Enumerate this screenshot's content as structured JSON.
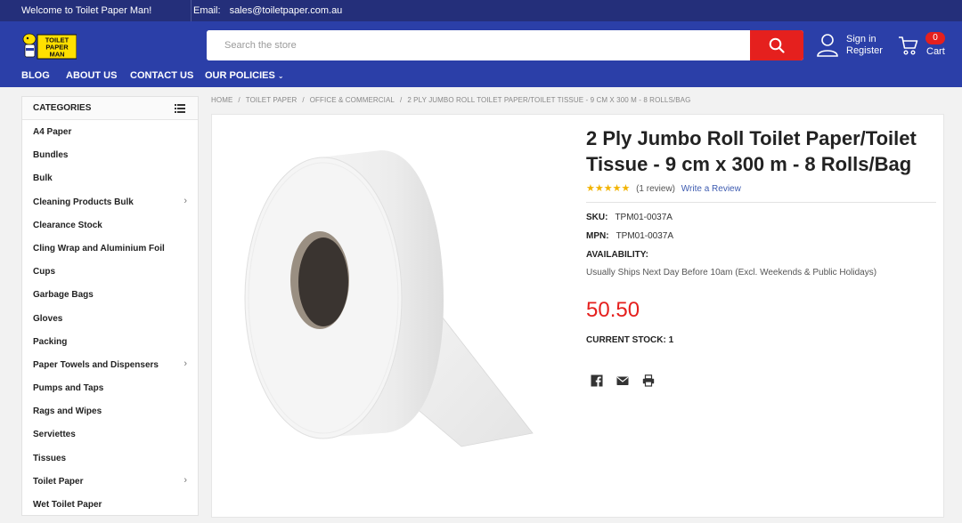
{
  "topbar": {
    "welcome": "Welcome to Toilet Paper Man!",
    "email_label": "Email:",
    "email_value": "sales@toiletpaper.com.au"
  },
  "header": {
    "logo_text": [
      "TOILET",
      "PAPER",
      "MAN"
    ],
    "search_placeholder": "Search the store",
    "account": {
      "signin": "Sign in",
      "register": "Register"
    },
    "cart": {
      "label": "Cart",
      "count": "0"
    },
    "colors": {
      "header_bg": "#2b3fa8",
      "topbar_bg": "#242f7a",
      "accent_red": "#e5201e",
      "logo_yellow": "#ffe000"
    }
  },
  "nav": {
    "items": [
      "BLOG",
      "ABOUT US",
      "CONTACT US",
      "OUR POLICIES"
    ]
  },
  "sidebar": {
    "heading": "CATEGORIES",
    "items": [
      {
        "label": "A4 Paper",
        "has_children": false
      },
      {
        "label": "Bundles",
        "has_children": false
      },
      {
        "label": "Bulk",
        "has_children": false
      },
      {
        "label": "Cleaning Products Bulk",
        "has_children": true
      },
      {
        "label": "Clearance Stock",
        "has_children": false
      },
      {
        "label": "Cling Wrap and Aluminium Foil",
        "has_children": false
      },
      {
        "label": "Cups",
        "has_children": false
      },
      {
        "label": "Garbage Bags",
        "has_children": false
      },
      {
        "label": "Gloves",
        "has_children": false
      },
      {
        "label": "Packing",
        "has_children": false
      },
      {
        "label": "Paper Towels and Dispensers",
        "has_children": true
      },
      {
        "label": "Pumps and Taps",
        "has_children": false
      },
      {
        "label": "Rags and Wipes",
        "has_children": false
      },
      {
        "label": "Serviettes",
        "has_children": false
      },
      {
        "label": "Tissues",
        "has_children": false
      },
      {
        "label": "Toilet Paper",
        "has_children": true
      },
      {
        "label": "Wet Toilet Paper",
        "has_children": false
      }
    ]
  },
  "breadcrumb": [
    "HOME",
    "TOILET PAPER",
    "OFFICE & COMMERCIAL",
    "2 PLY JUMBO ROLL TOILET PAPER/TOILET TISSUE - 9 CM X 300 M - 8 ROLLS/BAG"
  ],
  "product": {
    "title": "2 Ply Jumbo Roll Toilet Paper/Toilet Tissue - 9 cm x 300 m - 8 Rolls/Bag",
    "stars": "★★★★★",
    "rating_value": 5,
    "review_count": "(1 review)",
    "write_review": "Write a Review",
    "sku_label": "SKU:",
    "sku": "TPM01-0037A",
    "mpn_label": "MPN:",
    "mpn": "TPM01-0037A",
    "availability_label": "AVAILABILITY:",
    "availability": "Usually Ships Next Day Before 10am (Excl. Weekends & Public Holidays)",
    "price": "50.50",
    "stock_label": "CURRENT STOCK:",
    "stock": "1",
    "share_icons": [
      "facebook-icon",
      "email-icon",
      "print-icon"
    ]
  }
}
